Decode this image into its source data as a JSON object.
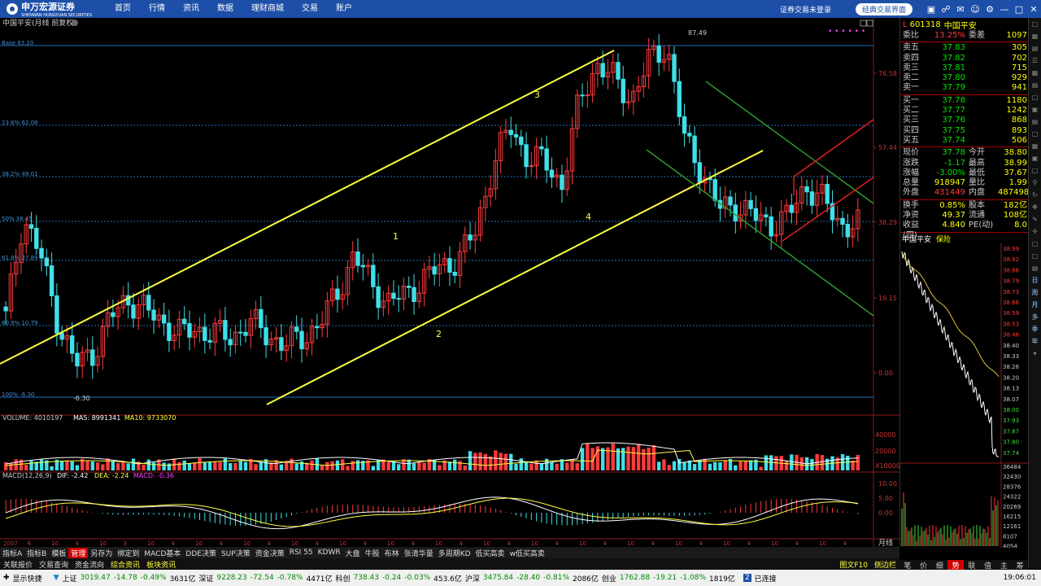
{
  "app": {
    "logo_text": "申万宏源证券",
    "logo_sub": "SHENWAN HONGYUAN SECURITIES",
    "nav": [
      "首页",
      "行情",
      "资讯",
      "数据",
      "理财商城",
      "交易",
      "账户"
    ],
    "login_text": "证券交易未登录",
    "classic_label": "经典交易界面"
  },
  "chart": {
    "title": "中国平安(月线 前复权)",
    "fib_labels": [
      "Base 83.20",
      "23.6% 62.08",
      "38.2% 49.01",
      "50% 38.45",
      "61.8% 27.89",
      "80.9% 10.79",
      "100% -6.30"
    ],
    "price_axis": [
      "76.58",
      "57.44",
      "38.29",
      "19.15",
      "0.00"
    ],
    "high_label": "87.49",
    "low_label": "-6.30",
    "wave_labels": [
      "1",
      "2",
      "3",
      "4"
    ],
    "volume_header": {
      "vol": "VOLUME: 4010197",
      "ma5": "MA5: 8991341",
      "ma10": "MA10: 9733070"
    },
    "volume_axis": [
      "40000",
      "20000",
      "X10000"
    ],
    "macd_header": {
      "label": "MACD(12,26,9)",
      "dif": "DIF: -2.42",
      "dea": "DEA: -2.24",
      "macd": "MACD: -0.36"
    },
    "macd_axis": [
      "10.00",
      "5.00",
      "0.00"
    ],
    "period_label": "月线",
    "start_year": "2007",
    "x_ticks": [
      "2007",
      "6",
      "10",
      "4",
      "10",
      "3",
      "10",
      "4",
      "10",
      "4",
      "10",
      "4",
      "10",
      "4",
      "10",
      "4",
      "10",
      "4",
      "10",
      "4",
      "10",
      "4",
      "10",
      "4",
      "10",
      "4",
      "10",
      "4",
      "10",
      "4",
      "10",
      "4",
      "10",
      "4",
      "10",
      "4"
    ]
  },
  "chart_data": {
    "type": "candlestick",
    "title": "中国平安(月线 前复权)",
    "ylim": [
      -6.3,
      87.49
    ],
    "close_approx": [
      14,
      40,
      30,
      13,
      2,
      5,
      14,
      19,
      16,
      13,
      10,
      11,
      10,
      9,
      13,
      10,
      7,
      9,
      12,
      20,
      30,
      23,
      18,
      20,
      24,
      27,
      29,
      36,
      53,
      63,
      55,
      54,
      48,
      70,
      79,
      75,
      70,
      80,
      84,
      60,
      52,
      42,
      43,
      40,
      38,
      40,
      48,
      44,
      38,
      37.78
    ]
  },
  "quote": {
    "code": "601318",
    "name": "中国平安",
    "webi_label": "委比",
    "webi": "13.25%",
    "weicha_label": "委差",
    "weicha": "1097",
    "sell": [
      {
        "label": "卖五",
        "price": "37.83",
        "vol": "305"
      },
      {
        "label": "卖四",
        "price": "37.82",
        "vol": "702"
      },
      {
        "label": "卖三",
        "price": "37.81",
        "vol": "715"
      },
      {
        "label": "卖二",
        "price": "37.80",
        "vol": "929"
      },
      {
        "label": "卖一",
        "price": "37.79",
        "vol": "941"
      }
    ],
    "buy": [
      {
        "label": "买一",
        "price": "37.78",
        "vol": "1180"
      },
      {
        "label": "买二",
        "price": "37.77",
        "vol": "1242"
      },
      {
        "label": "买三",
        "price": "37.76",
        "vol": "868"
      },
      {
        "label": "买四",
        "price": "37.75",
        "vol": "893"
      },
      {
        "label": "买五",
        "price": "37.74",
        "vol": "506"
      }
    ],
    "stats": [
      {
        "l": "现价",
        "v": "37.78",
        "vc": "green",
        "l2": "今开",
        "v2": "38.80",
        "v2c": "red"
      },
      {
        "l": "涨跌",
        "v": "-1.17",
        "vc": "green",
        "l2": "最高",
        "v2": "38.99",
        "v2c": "red"
      },
      {
        "l": "涨幅",
        "v": "-3.00%",
        "vc": "green",
        "l2": "最低",
        "v2": "37.67",
        "v2c": "green"
      },
      {
        "l": "总量",
        "v": "918947",
        "vc": "yellow",
        "l2": "量比",
        "v2": "1.99",
        "v2c": "red"
      },
      {
        "l": "外盘",
        "v": "431449",
        "vc": "red",
        "l2": "内盘",
        "v2": "487498",
        "v2c": "green"
      }
    ],
    "stats2": [
      {
        "l": "换手",
        "v": "0.85%",
        "l2": "股本",
        "v2": "182亿"
      },
      {
        "l": "净资",
        "v": "49.37",
        "l2": "流通",
        "v2": "108亿"
      },
      {
        "l": "收益(四)",
        "v": "4.840",
        "l2": "PE(动)",
        "v2": "8.0"
      }
    ],
    "mini_tabs": [
      "中国平安",
      "保险"
    ],
    "intraday_axis": [
      "38.99",
      "38.92",
      "38.86",
      "38.79",
      "38.73",
      "38.66",
      "38.59",
      "38.53",
      "38.46",
      "38.40",
      "38.33",
      "38.26",
      "38.20",
      "38.13",
      "38.07",
      "38.00",
      "37.93",
      "37.87",
      "37.80",
      "37.74"
    ],
    "intraday_vol_axis": [
      "36484",
      "32430",
      "28376",
      "24322",
      "20269",
      "16215",
      "12161",
      "8107",
      "4054"
    ],
    "bottom_tabs": [
      "笔",
      "价",
      "细",
      "势",
      "联",
      "值",
      "主",
      "筹"
    ]
  },
  "tool_tabs": [
    "指标A",
    "指标B",
    "模板",
    "管理",
    "另存为",
    "绑定到",
    "MACD基本",
    "DDE决策",
    "SUP决策",
    "资金决策",
    "RSI 55",
    "KDWR",
    "大盘",
    "牛股",
    "布林",
    "张清华量",
    "多周期KD",
    "低买高卖",
    "w低买高卖"
  ],
  "tool_tabs2": [
    "关联报价",
    "交易查询",
    "资金流向",
    "综合资讯",
    "板块资讯"
  ],
  "tool_tabs2_right": [
    "图文F10",
    "侧边栏"
  ],
  "status": {
    "quick": "显示快捷",
    "sh": "上证",
    "sh_v": "3019.47",
    "sh_c": "-14.78",
    "sh_p": "-0.49%",
    "sh_a": "3631亿",
    "sz": "深证",
    "sz_v": "9228.23",
    "sz_c": "-72.54",
    "sz_p": "-0.78%",
    "sz_a": "4471亿",
    "kc": "科创",
    "kc_v": "738.43",
    "kc_c": "-0.24",
    "kc_p": "-0.03%",
    "kc_a": "453.6亿",
    "hs": "沪深",
    "hs_v": "3475.84",
    "hs_c": "-28.40",
    "hs_p": "-0.81%",
    "hs_a": "2086亿",
    "cy": "创业",
    "cy_v": "1762.88",
    "cy_c": "-19.21",
    "cy_p": "-1.08%",
    "cy_a": "1819亿",
    "conn": "已连接",
    "time": "19:06:01"
  }
}
